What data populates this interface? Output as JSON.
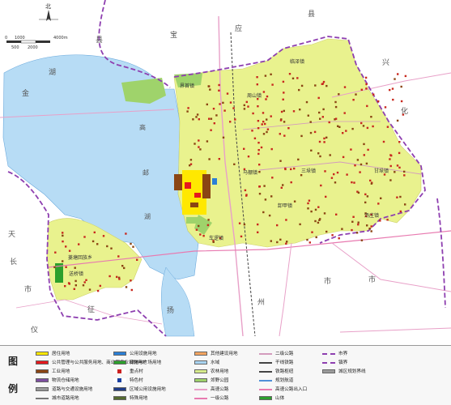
{
  "map": {
    "north_label": "北",
    "scale_top": [
      "0",
      "1000",
      "4000m"
    ],
    "scale_bottom": [
      "500",
      "2000"
    ],
    "region_chars_outside": [
      "县",
      "宝",
      "应",
      "县",
      "兴",
      "化",
      "湖",
      "金",
      "天",
      "长",
      "市",
      "仪",
      "征",
      "扬",
      "州",
      "市",
      "市"
    ],
    "lake_chars": [
      "高",
      "邮",
      "湖"
    ],
    "town_labels": [
      "临泽镇",
      "界首镇",
      "周山镇",
      "马棚镇",
      "三垛镇",
      "车逻镇",
      "卸甲镇",
      "汤庄镇",
      "菱塘回族乡",
      "送桥镇",
      "甘垛镇",
      "八桥镇",
      "龙虬镇"
    ]
  },
  "legend": {
    "title_top": "图",
    "title_bottom": "例",
    "items": [
      {
        "label": "居住用地",
        "color": "#ffe800",
        "kind": "swatch"
      },
      {
        "label": "公共管理与公共服务用地、商业服务业设施用地",
        "color": "#e5191e",
        "kind": "swatch"
      },
      {
        "label": "工业用地",
        "color": "#8b4513",
        "kind": "swatch"
      },
      {
        "label": "物流仓储用地",
        "color": "#7d4fa0",
        "kind": "swatch"
      },
      {
        "label": "道路与交通设施用地",
        "color": "#9a9a9a",
        "kind": "swatch"
      },
      {
        "label": "城市道路用地",
        "color": "#777777",
        "kind": "line"
      },
      {
        "label": "公用设施用地",
        "color": "#2b7fd6",
        "kind": "swatch"
      },
      {
        "label": "绿地与广场用地",
        "color": "#2ca02c",
        "kind": "swatch"
      },
      {
        "label": "重点村",
        "color": "#cc2222",
        "kind": "dot"
      },
      {
        "label": "特色村",
        "color": "#1a3fa0",
        "kind": "dot"
      },
      {
        "label": "区域公用设施用地",
        "color": "#1f3c88",
        "kind": "swatch"
      },
      {
        "label": "特殊用地",
        "color": "#556b2f",
        "kind": "swatch"
      },
      {
        "label": "其他建设用地",
        "color": "#f4a460",
        "kind": "swatch"
      },
      {
        "label": "水域",
        "color": "#a9d4f2",
        "kind": "swatch"
      },
      {
        "label": "农林用地",
        "color": "#d7ec8c",
        "kind": "swatch"
      },
      {
        "label": "郊野公园",
        "color": "#9fd36b",
        "kind": "swatch"
      },
      {
        "label": "高速公路",
        "color": "#e8a0c8",
        "kind": "line"
      },
      {
        "label": "一级公路",
        "color": "#e87ab0",
        "kind": "line"
      },
      {
        "label": "二级公路",
        "color": "#d39bbd",
        "kind": "line"
      },
      {
        "label": "干线铁路",
        "color": "#444444",
        "kind": "line"
      },
      {
        "label": "铁路枢纽",
        "color": "#444444",
        "kind": "line"
      },
      {
        "label": "规划航道",
        "color": "#4f90d8",
        "kind": "line"
      },
      {
        "label": "高速公路出入口",
        "color": "#e87ab0",
        "kind": "line"
      },
      {
        "label": "山体",
        "color": "#2ca02c",
        "kind": "swatch"
      },
      {
        "label": "市界",
        "color": "#8e3fb0",
        "kind": "line"
      },
      {
        "label": "镇界",
        "color": "#8e3fb0",
        "kind": "line"
      },
      {
        "label": "城区规划界线",
        "color": "#9b9b9b",
        "kind": "swatch"
      }
    ]
  }
}
